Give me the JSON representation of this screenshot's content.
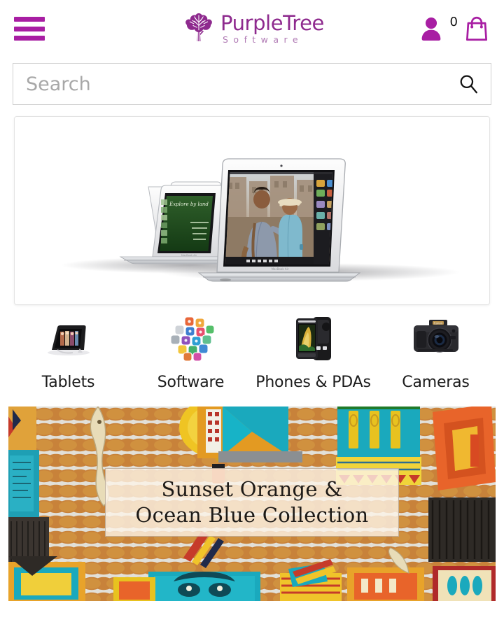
{
  "header": {
    "menu_icon": "hamburger-menu-icon",
    "logo": {
      "icon": "tree-icon",
      "name": "PurpleTree",
      "tagline": "Software"
    },
    "account_icon": "user-account-icon",
    "cart": {
      "count": "0",
      "icon": "shopping-bag-icon"
    }
  },
  "search": {
    "placeholder": "Search",
    "value": "",
    "button_icon": "search-icon"
  },
  "hero": {
    "name": "macbook-air-banner",
    "alt": "MacBook Air laptops"
  },
  "categories": [
    {
      "label": "Tablets",
      "icon": "tablet-icon"
    },
    {
      "label": "Software",
      "icon": "software-apps-icon"
    },
    {
      "label": "Phones & PDAs",
      "icon": "smartphone-icon"
    },
    {
      "label": "Cameras",
      "icon": "dslr-camera-icon"
    }
  ],
  "promo": {
    "line1": "Sunset Orange &",
    "line2": "Ocean Blue Collection"
  },
  "colors": {
    "brand_purple": "#a81ea3",
    "logo_purple": "#8e2a8e",
    "logo_light_purple": "#b07ab4",
    "text_dark": "#1c1c1c",
    "placeholder_gray": "#a8a8a8",
    "border_gray": "#cfcfcf"
  }
}
